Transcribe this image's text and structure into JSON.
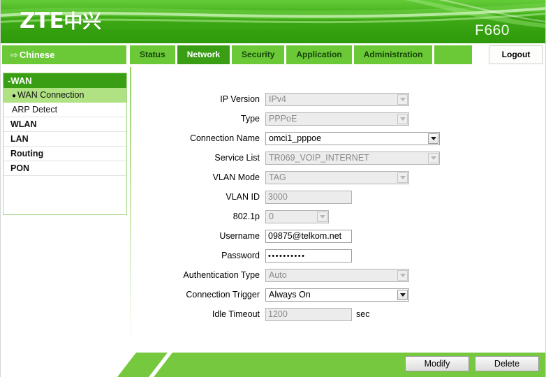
{
  "header": {
    "logo_latin": "ZTE",
    "logo_cjk": "中兴",
    "model": "F660"
  },
  "nav": {
    "language_arrow": "arrow-right-icon",
    "language_label": "Chinese",
    "tabs": [
      {
        "label": "Status",
        "active": false
      },
      {
        "label": "Network",
        "active": true
      },
      {
        "label": "Security",
        "active": false
      },
      {
        "label": "Application",
        "active": false
      },
      {
        "label": "Administration",
        "active": false
      }
    ],
    "logout_label": "Logout"
  },
  "sidebar": {
    "group_header": "-WAN",
    "items": [
      {
        "label": "WAN Connection",
        "selected": true,
        "bullet": "●"
      },
      {
        "label": "ARP Detect",
        "selected": false,
        "bullet": ""
      },
      {
        "label": "WLAN",
        "selected": false,
        "bullet": ""
      },
      {
        "label": "LAN",
        "selected": false,
        "bullet": ""
      },
      {
        "label": "Routing",
        "selected": false,
        "bullet": ""
      },
      {
        "label": "PON",
        "selected": false,
        "bullet": ""
      }
    ]
  },
  "form": {
    "ip_version": {
      "label": "IP Version",
      "value": "IPv4"
    },
    "type": {
      "label": "Type",
      "value": "PPPoE"
    },
    "connection_name": {
      "label": "Connection Name",
      "value": "omci1_pppoe"
    },
    "service_list": {
      "label": "Service List",
      "value": "TR069_VOIP_INTERNET"
    },
    "vlan_mode": {
      "label": "VLAN Mode",
      "value": "TAG"
    },
    "vlan_id": {
      "label": "VLAN ID",
      "value": "3000"
    },
    "dot1p": {
      "label": "802.1p",
      "value": "0"
    },
    "username": {
      "label": "Username",
      "value": "09875@telkom.net"
    },
    "password": {
      "label": "Password",
      "value": "••••••••••"
    },
    "auth_type": {
      "label": "Authentication Type",
      "value": "Auto"
    },
    "connection_trigger": {
      "label": "Connection Trigger",
      "value": "Always On"
    },
    "idle_timeout": {
      "label": "Idle Timeout",
      "value": "1200",
      "unit": "sec"
    }
  },
  "footer": {
    "modify_label": "Modify",
    "delete_label": "Delete"
  },
  "colors": {
    "brand_green": "#3a9e14",
    "tab_green": "#6bc836",
    "selected_green": "#b0e283",
    "stripe_green": "#76c83f"
  }
}
